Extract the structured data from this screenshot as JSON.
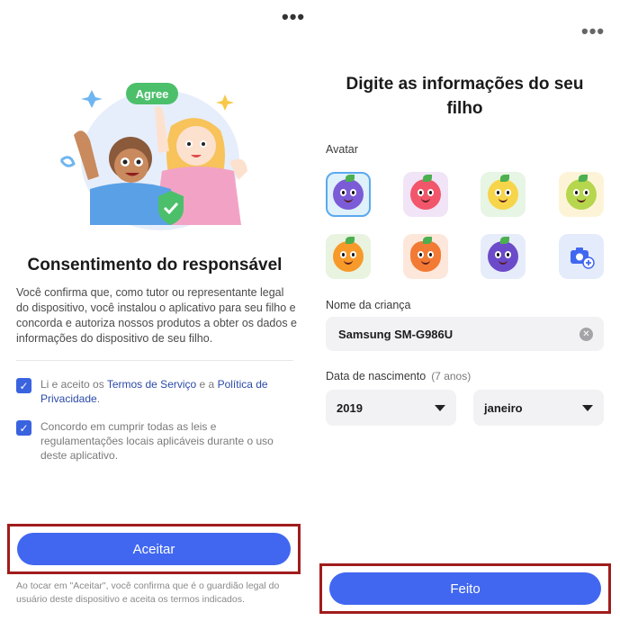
{
  "left": {
    "more_label": "•••",
    "illustration": {
      "badge_text": "Agree"
    },
    "title": "Consentimento do responsável",
    "description": "Você confirma que, como tutor ou representante legal do dispositivo, você instalou o aplicativo para seu filho e concorda e autoriza nossos produtos a obter os dados e informações do dispositivo de seu filho.",
    "consent_1": {
      "prefix": "Li e aceito os ",
      "terms_link": "Termos de Serviço",
      "middle": " e a ",
      "privacy_link": "Política de Privacidade",
      "suffix": ".",
      "checked": true
    },
    "consent_2": {
      "text": "Concordo em cumprir todas as leis e regulamentações locais aplicáveis durante o uso deste aplicativo.",
      "checked": true
    },
    "accept_button": "Aceitar",
    "footer_note": "Ao tocar em \"Aceitar\", você confirma que é o guardião legal do usuário deste dispositivo e aceita os termos indicados."
  },
  "right": {
    "more_label": "•••",
    "title": "Digite as informações do seu filho",
    "avatar_label": "Avatar",
    "avatars": [
      {
        "name": "grape",
        "bg": "#dff1fb",
        "color": "#7b5bd6",
        "selected": true
      },
      {
        "name": "apple",
        "bg": "#f1e4f7",
        "color": "#f2566a",
        "selected": false
      },
      {
        "name": "pineapple",
        "bg": "#e6f5e4",
        "color": "#f7d54a",
        "selected": false
      },
      {
        "name": "pear",
        "bg": "#fdf4d8",
        "color": "#b6d64e",
        "selected": false
      },
      {
        "name": "orange",
        "bg": "#e8f3e0",
        "color": "#f79a2a",
        "selected": false
      },
      {
        "name": "carrot",
        "bg": "#fde7da",
        "color": "#f27a35",
        "selected": false
      },
      {
        "name": "eggplant",
        "bg": "#e6ecf9",
        "color": "#6b4bc9",
        "selected": false
      },
      {
        "name": "camera-add",
        "bg": "#e4ecfb",
        "color": "#4167f1",
        "selected": false
      }
    ],
    "name_label": "Nome da criança",
    "name_value": "Samsung SM-G986U",
    "birth_label": "Data de nascimento",
    "age_hint": "(7 anos)",
    "year_value": "2019",
    "month_value": "janeiro",
    "done_button": "Feito"
  },
  "colors": {
    "primary": "#4167f1",
    "highlight_frame": "#a01c1c",
    "checkbox": "#3a63e0",
    "link": "#2b4aa8"
  }
}
